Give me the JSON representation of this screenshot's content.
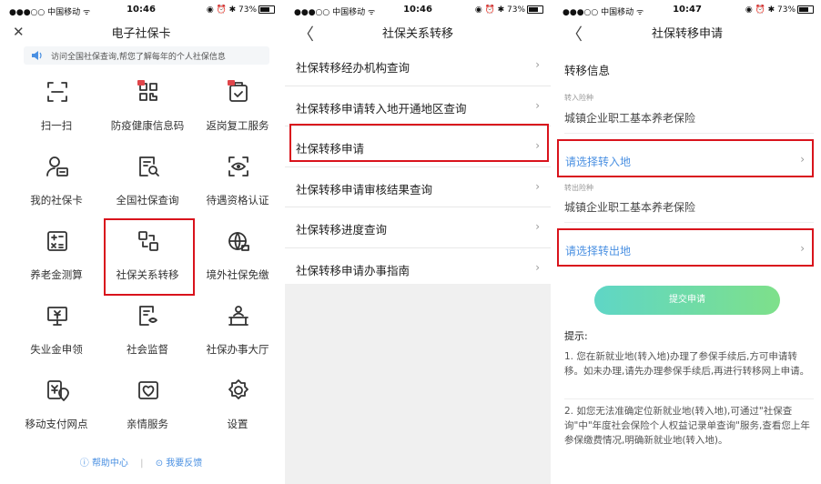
{
  "status": [
    {
      "carrier": "●●●○○ 中国移动 ᯤ",
      "time": "10:46",
      "right": "◉ ⏰ ✱ 73%"
    },
    {
      "carrier": "●●●○○ 中国移动 ᯤ",
      "time": "10:46",
      "right": "◉ ⏰ ✱ 73%"
    },
    {
      "carrier": "●●●○○ 中国移动 ᯤ",
      "time": "10:47",
      "right": "◉ ⏰ ✱ 73%"
    }
  ],
  "panel1": {
    "title": "电子社保卡",
    "close": "✕",
    "notice": "访问全国社保查询,帮您了解每年的个人社保信息",
    "items": [
      {
        "label": "扫一扫",
        "icon": "scan-icon"
      },
      {
        "label": "防疫健康信息码",
        "icon": "health-code-icon"
      },
      {
        "label": "返岗复工服务",
        "icon": "return-work-icon"
      },
      {
        "label": "我的社保卡",
        "icon": "user-card-icon"
      },
      {
        "label": "全国社保查询",
        "icon": "search-doc-icon"
      },
      {
        "label": "待遇资格认证",
        "icon": "eye-scan-icon"
      },
      {
        "label": "养老金测算",
        "icon": "calculator-icon"
      },
      {
        "label": "社保关系转移",
        "icon": "transfer-icon"
      },
      {
        "label": "境外社保免缴",
        "icon": "globe-icon"
      },
      {
        "label": "失业金申领",
        "icon": "monitor-yuan-icon"
      },
      {
        "label": "社会监督",
        "icon": "doc-eye-icon"
      },
      {
        "label": "社保办事大厅",
        "icon": "counter-icon"
      },
      {
        "label": "移动支付网点",
        "icon": "pay-location-icon"
      },
      {
        "label": "亲情服务",
        "icon": "heart-plus-icon"
      },
      {
        "label": "设置",
        "icon": "gear-icon"
      }
    ],
    "help": "帮助中心",
    "feedback": "我要反馈"
  },
  "panel2": {
    "title": "社保关系转移",
    "back": "〈",
    "items": [
      "社保转移经办机构查询",
      "社保转移申请转入地开通地区查询",
      "社保转移申请",
      "社保转移申请审核结果查询",
      "社保转移进度查询",
      "社保转移申请办事指南"
    ]
  },
  "panel3": {
    "title": "社保转移申请",
    "back": "〈",
    "section": "转移信息",
    "in_caption": "转入险种",
    "in_value": "城镇企业职工基本养老保险",
    "in_pick": "请选择转入地",
    "out_caption": "转出险种",
    "out_value": "城镇企业职工基本养老保险",
    "out_pick": "请选择转出地",
    "submit": "提交申请",
    "tips_title": "提示:",
    "tip1": "1. 您在新就业地(转入地)办理了参保手续后,方可申请转移。如未办理,请先办理参保手续后,再进行转移网上申请。",
    "tip2": "2. 如您无法准确定位新就业地(转入地),可通过\"社保查询\"中\"年度社会保险个人权益记录单查询\"服务,查看您上年参保缴费情况,明确新就业地(转入地)。"
  },
  "chevron": "›",
  "colors": {
    "highlight": "#d9131c",
    "link": "#4a90e2",
    "icon": "#333333",
    "badge": "#e0454a"
  }
}
